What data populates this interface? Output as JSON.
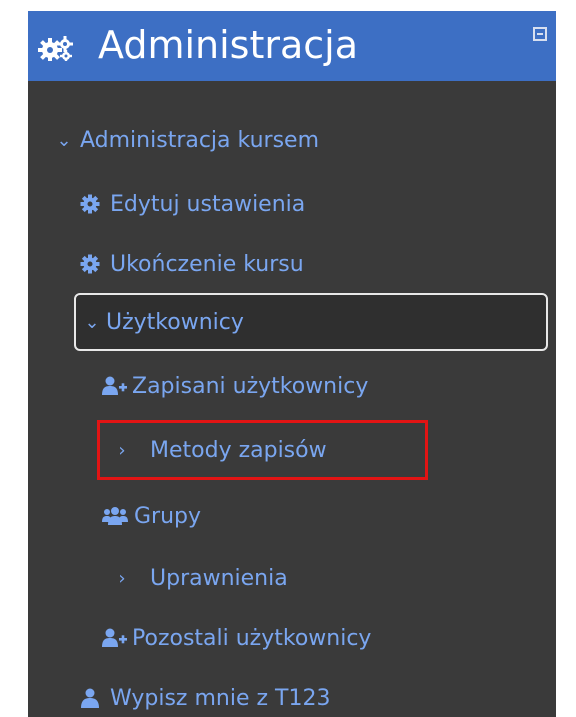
{
  "block": {
    "title": "Administracja",
    "header_icon": "gears-icon",
    "collapse_icon": "collapse-icon"
  },
  "nav": {
    "course_admin": "Administracja kursem",
    "edit_settings": "Edytuj ustawienia",
    "course_completion": "Ukończenie kursu",
    "users": "Użytkownicy",
    "enrolled_users": "Zapisani użytkownicy",
    "enrolment_methods": "Metody zapisów",
    "groups": "Grupy",
    "permissions": "Uprawnienia",
    "other_users": "Pozostali użytkownicy",
    "unenrol": "Wypisz mnie z T123"
  },
  "colors": {
    "header_bg": "#3d6fc4",
    "panel_bg": "#3a3a3a",
    "link": "#7aa6f0",
    "highlight": "#e21414"
  }
}
